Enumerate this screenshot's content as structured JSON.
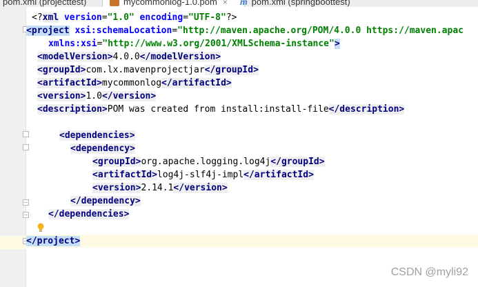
{
  "tabs": [
    {
      "label": "pom.xml (projecttest)",
      "active": false
    },
    {
      "label": "mycommonlog-1.0.pom",
      "active": true,
      "icon": "xml-file-icon"
    },
    {
      "label": "pom.xml (springboottest)",
      "active": false,
      "icon": "maven-icon"
    }
  ],
  "code": {
    "l1_pi_open": "<?",
    "l1_xml": "xml",
    "l1_version_attr": " version",
    "l1_eq1": "=",
    "l1_version_val": "\"1.0\"",
    "l1_encoding_attr": " encoding",
    "l1_eq2": "=",
    "l1_encoding_val": "\"UTF-8\"",
    "l1_pi_close": "?>",
    "l2_open": "<project",
    "l2_attr": " xsi:schemaLocation",
    "l2_eq": "=",
    "l2_val": "\"http://maven.apache.org/POM/4.0.0 https://maven.apac",
    "l3_attr": "xmlns:xsi",
    "l3_eq": "=",
    "l3_val": "\"http://www.w3.org/2001/XMLSchema-instance\"",
    "l3_close": ">",
    "modelVersion_open": "<modelVersion>",
    "modelVersion_val": "4.0.0",
    "modelVersion_close": "</modelVersion>",
    "groupId_open": "<groupId>",
    "groupId_val": "com.lx.mavenprojectjar",
    "groupId_close": "</groupId>",
    "artifactId_open": "<artifactId>",
    "artifactId_val": "mycommonlog",
    "artifactId_close": "</artifactId>",
    "version_open": "<version>",
    "version_val": "1.0",
    "version_close": "</version>",
    "description_open": "<description>",
    "description_val": "POM was created from install:install-file",
    "description_close": "</description>",
    "deps_open": "<dependencies>",
    "dep_open": "<dependency>",
    "d_groupId_open": "<groupId>",
    "d_groupId_val": "org.apache.logging.log4j",
    "d_groupId_close": "</groupId>",
    "d_artifactId_open": "<artifactId>",
    "d_artifactId_val": "log4j-slf4j-impl",
    "d_artifactId_close": "</artifactId>",
    "d_version_open": "<version>",
    "d_version_val": "2.14.1",
    "d_version_close": "</version>",
    "dep_close": "</dependency>",
    "deps_close": "</dependencies>",
    "project_close": "</project>"
  },
  "watermark": "CSDN @myli92",
  "colors": {
    "tag": "#000080",
    "attr": "#0000ff",
    "string": "#008000",
    "caret_line": "#fffae3",
    "tag_highlight": "#c5dff6"
  }
}
